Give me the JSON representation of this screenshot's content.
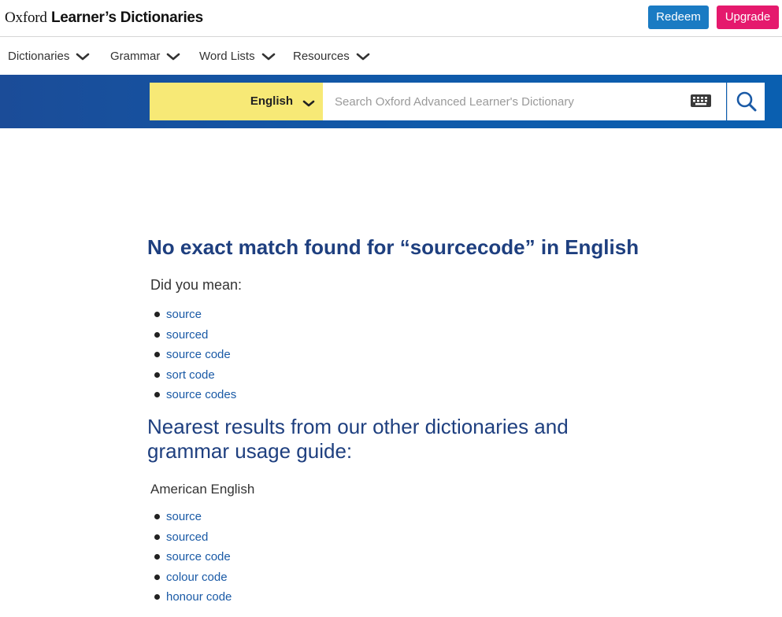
{
  "header": {
    "logo_light": "Oxford",
    "logo_bold": "Learner’s Dictionaries",
    "redeem_label": "Redeem",
    "upgrade_label": "Upgrade"
  },
  "nav": {
    "items": [
      {
        "label": "Dictionaries"
      },
      {
        "label": "Grammar"
      },
      {
        "label": "Word Lists"
      },
      {
        "label": "Resources"
      }
    ]
  },
  "search": {
    "language": "English",
    "placeholder": "Search Oxford Advanced Learner's Dictionary",
    "value": ""
  },
  "results": {
    "heading": "No exact match found for “sourcecode” in English",
    "did_you_mean_label": "Did you mean:",
    "suggestions": [
      "source",
      "sourced",
      "source code",
      "sort code",
      "source codes"
    ],
    "other_heading": "Nearest results from our other dictionaries and grammar usage guide:",
    "american_label": "American English",
    "american_suggestions": [
      "source",
      "sourced",
      "source code",
      "colour code",
      "honour code"
    ]
  },
  "colors": {
    "brand_blue": "#1e3f7f",
    "link_blue": "#1a5aa6",
    "redeem": "#1a7bc3",
    "upgrade": "#e5196d",
    "lang_select": "#f7e976",
    "band": "#0f5aaa"
  }
}
